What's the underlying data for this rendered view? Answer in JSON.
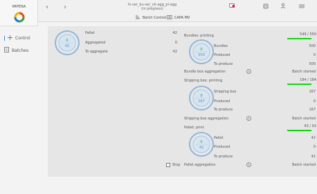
{
  "brand": {
    "name": "IMPERA"
  },
  "header": {
    "title_line1": "fs-var_bu-ser_vk-agg_pl-agg",
    "title_line2": "(in progress)",
    "tabs": [
      "Batch Control",
      "CAPA MV"
    ]
  },
  "sidebar": {
    "items": [
      {
        "label": "Control"
      },
      {
        "label": "Batches"
      }
    ]
  },
  "left_panel": {
    "ring": {
      "top": "0",
      "bottom": "42"
    },
    "rows": [
      {
        "label": "Pallet",
        "value": "42"
      },
      {
        "label": "Aggregated",
        "value": "0"
      },
      {
        "label": "To aggregate",
        "value": "42"
      }
    ],
    "stop_label": "Stop"
  },
  "right_panel": {
    "bundles": {
      "header": "Bundles: printing",
      "progress": "549 / 550",
      "progress_fraction": 0.998,
      "ring": {
        "top": "0",
        "bottom": "550"
      },
      "rows": [
        {
          "label": "Bundles",
          "value": "500"
        },
        {
          "label": "Produced",
          "value": "0"
        },
        {
          "label": "To produce",
          "value": "500"
        }
      ]
    },
    "bundle_aggregation": {
      "label": "Bundle box aggregation",
      "status": "Batch started"
    },
    "shipping": {
      "header": "Shipping box: printing",
      "progress": "184 / 184",
      "progress_fraction": 1.0,
      "ring": {
        "top": "0",
        "bottom": "167"
      },
      "rows": [
        {
          "label": "Shipping box",
          "value": "167"
        },
        {
          "label": "Produced",
          "value": "0"
        },
        {
          "label": "To produce",
          "value": "167"
        }
      ]
    },
    "shipping_aggregation": {
      "label": "Shipping box aggregation",
      "status": "Batch started"
    },
    "pallet": {
      "header": "Pallet: print",
      "progress": "93 / 93",
      "progress_fraction": 1.0,
      "ring": {
        "top": "0",
        "bottom": "42"
      },
      "rows": [
        {
          "label": "Pallet",
          "value": "42"
        },
        {
          "label": "Produced",
          "value": "0"
        },
        {
          "label": "To produce",
          "value": "42"
        }
      ]
    },
    "pallet_aggregation": {
      "label": "Pallet aggregation",
      "status": "Batch started"
    }
  },
  "colors": {
    "progress_green": "#11d411",
    "ring_blue": "#8fb7da",
    "alert_red": "#e3173c"
  }
}
